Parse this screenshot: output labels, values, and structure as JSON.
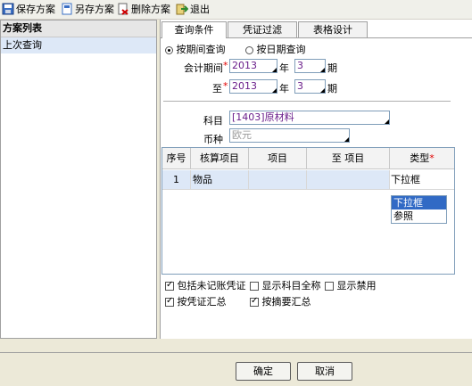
{
  "toolbar": {
    "save_scheme": "保存方案",
    "save_as_scheme": "另存方案",
    "delete_scheme": "删除方案",
    "exit": "退出"
  },
  "sidebar": {
    "header": "方案列表",
    "items": [
      {
        "label": "上次查询"
      }
    ]
  },
  "tabs": [
    {
      "label": "查询条件",
      "active": true
    },
    {
      "label": "凭证过滤",
      "active": false
    },
    {
      "label": "表格设计",
      "active": false
    }
  ],
  "query": {
    "by_period": "按期间查询",
    "by_date": "按日期查询",
    "period_label": "会计期间",
    "to_label": "至",
    "year_unit": "年",
    "period_unit": "期",
    "from_year": "2013",
    "from_period": "3",
    "to_year": "2013",
    "to_period": "3",
    "subject_label": "科目",
    "subject_value": "[1403]原材料",
    "currency_label": "币种",
    "currency_value": "欧元"
  },
  "grid": {
    "headers": [
      "序号",
      "核算项目",
      "项目",
      "至 项目",
      "类型"
    ],
    "rows": [
      {
        "no": "1",
        "item": "物品",
        "from": "",
        "to": "",
        "type": "下拉框"
      }
    ],
    "dropdown_options": [
      "下拉框",
      "参照"
    ]
  },
  "options": {
    "include_unposted": "包括未记账凭证",
    "show_full_subject": "显示科目全称",
    "show_disabled": "显示禁用",
    "summary_by_voucher": "按凭证汇总",
    "summary_by_digest": "按摘要汇总"
  },
  "buttons": {
    "ok": "确定",
    "cancel": "取消"
  },
  "colors": {
    "accent": "#316ac5",
    "required": "#e00000",
    "selection": "#dde8f7"
  }
}
